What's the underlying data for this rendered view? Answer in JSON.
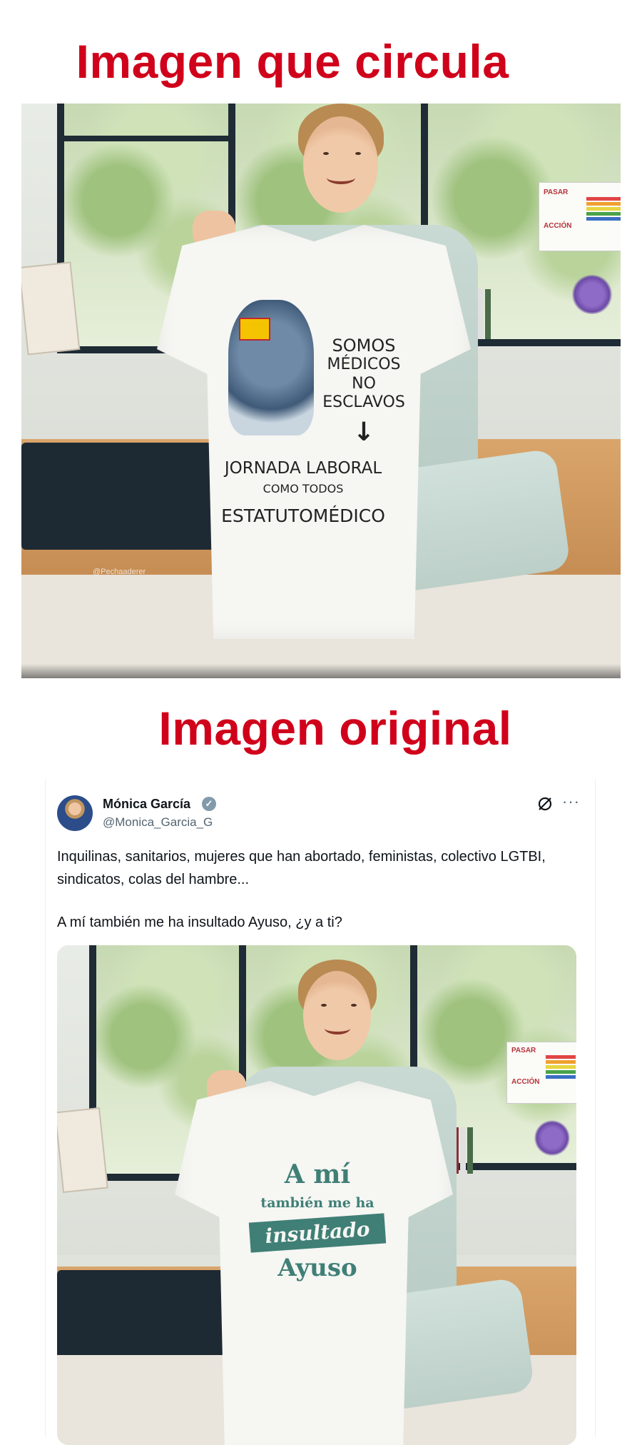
{
  "headings": {
    "circulating": "Imagen que circula",
    "original": "Imagen original"
  },
  "circulating_photo": {
    "shirt_lines": [
      "SOMOS",
      "MÉDICOS",
      "NO",
      "ESCLAVOS",
      "↓",
      "JORNADA LABORAL",
      "COMO TODOS",
      "ESTATUTOMÉDICO"
    ],
    "watermark": "@Pechaaderer",
    "poster_text": [
      "PASAR",
      "ACCIÓN"
    ]
  },
  "tweet": {
    "author_name": "Mónica García",
    "handle": "@Monica_Garcia_G",
    "verified_symbol": "✓",
    "more_symbol": "···",
    "text_line1": "Inquilinas, sanitarios, mujeres que han abortado, feministas, colectivo LGTBI, sindicatos, colas del hambre...",
    "text_line2": "A mí también me ha insultado Ayuso, ¿y a ti?",
    "shirt_lines": [
      "A mí",
      "también me ha",
      "insultado",
      "Ayuso"
    ],
    "poster_text": [
      "PASAR",
      "ACCIÓN"
    ]
  },
  "icons": [
    "verified-badge-icon",
    "grok-icon",
    "more-options-icon"
  ],
  "colors": {
    "heading_red": "#d0021b",
    "shirt_green": "#3f7f76",
    "tweet_text": "#0f1419",
    "tweet_muted": "#536471"
  }
}
